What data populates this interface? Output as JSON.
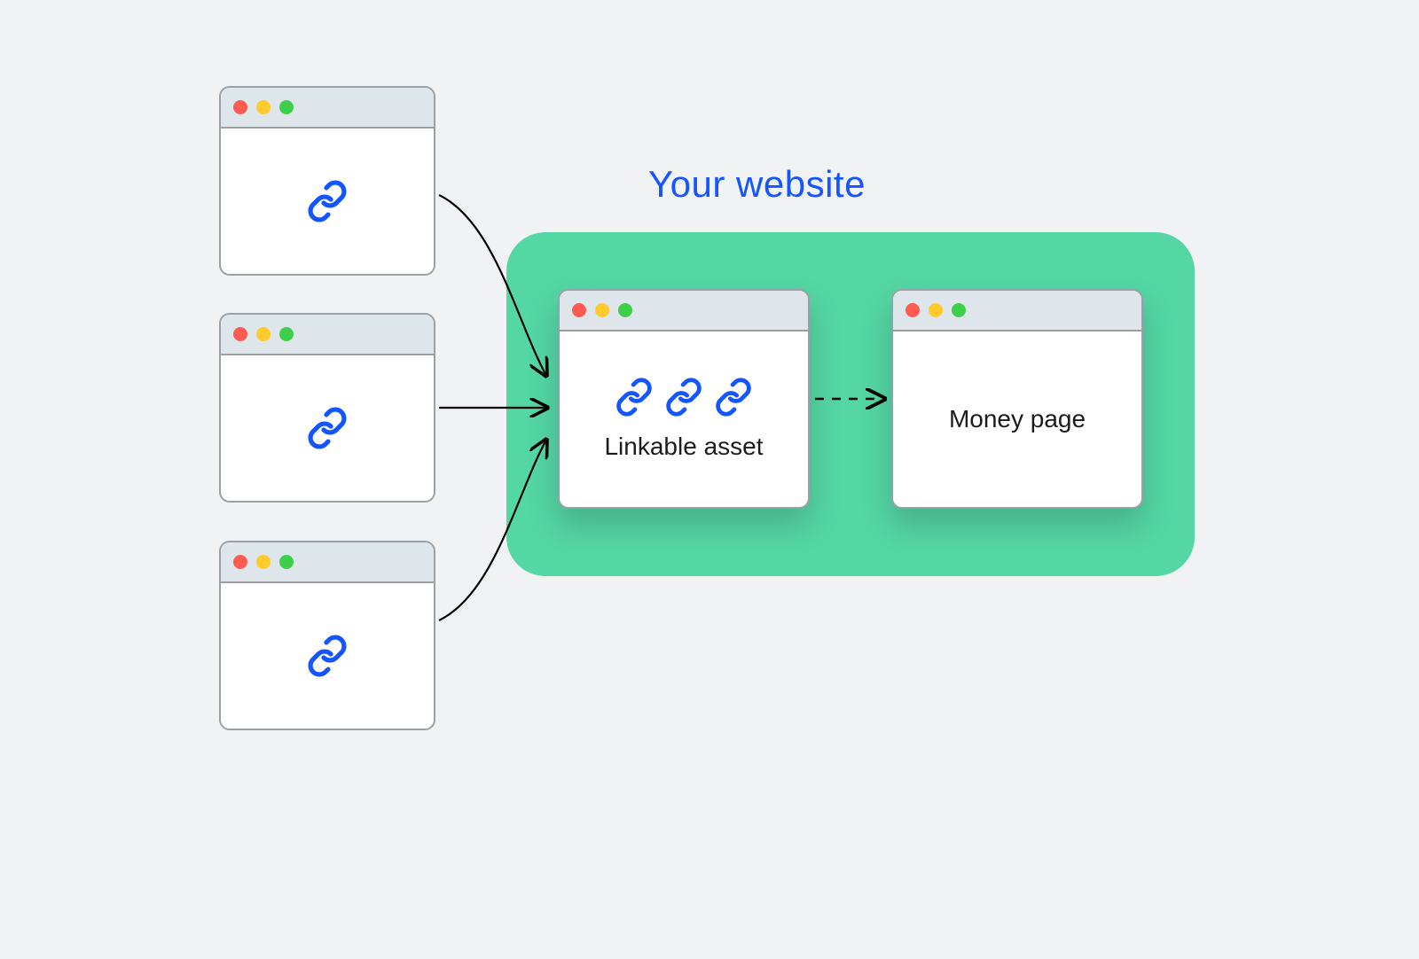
{
  "diagram": {
    "title": "Your website",
    "linkable_asset_label": "Linkable asset",
    "money_page_label": "Money page",
    "external_sources_count": 3,
    "colors": {
      "background": "#f0f2f4",
      "site_box": "#54d6a5",
      "title_text": "#1455ff",
      "window_border": "#9aa0a6",
      "titlebar": "#dfe6eb",
      "dot_red": "#ff5b52",
      "dot_yellow": "#ffca2c",
      "dot_green": "#3ecf4a",
      "link_icon": "#1455ff"
    },
    "icons": {
      "link": "link-icon",
      "traffic_red": "traffic-light-red",
      "traffic_yellow": "traffic-light-yellow",
      "traffic_green": "traffic-light-green"
    },
    "arrows": {
      "external_to_linkable": "solid",
      "linkable_to_money": "dashed"
    }
  }
}
